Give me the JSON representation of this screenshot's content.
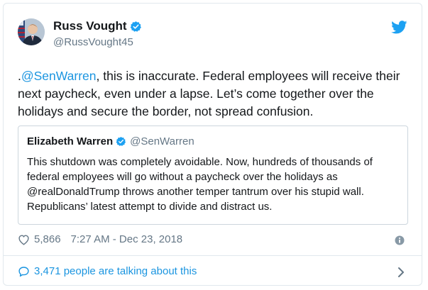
{
  "author": {
    "name": "Russ Vought",
    "handle": "@RussVought45"
  },
  "tweet": {
    "lead": ".",
    "mention": "@SenWarren",
    "text": ", this is inaccurate. Federal employees will receive their next paycheck, even under a lapse. Let’s come together over the holidays and secure the border, not spread confusion."
  },
  "quoted": {
    "name": "Elizabeth Warren",
    "handle": "@SenWarren",
    "text": "This shutdown was completely avoidable. Now, hundreds of thousands of federal employees will go without a paycheck over the holidays as @realDonaldTrump throws another temper tantrum over his stupid wall. Republicans’ latest attempt to divide and distract us."
  },
  "meta": {
    "likes": "5,866",
    "timestamp": "7:27 AM - Dec 23, 2018"
  },
  "talking": {
    "label": "3,471 people are talking about this"
  },
  "colors": {
    "link": "#1b95e0",
    "muted": "#657786",
    "text": "#14171a",
    "border": "#e1e8ed"
  },
  "icons": [
    "verified-badge-icon",
    "twitter-bird-icon",
    "heart-icon",
    "info-icon",
    "reply-bubble-icon",
    "chevron-right-icon"
  ]
}
